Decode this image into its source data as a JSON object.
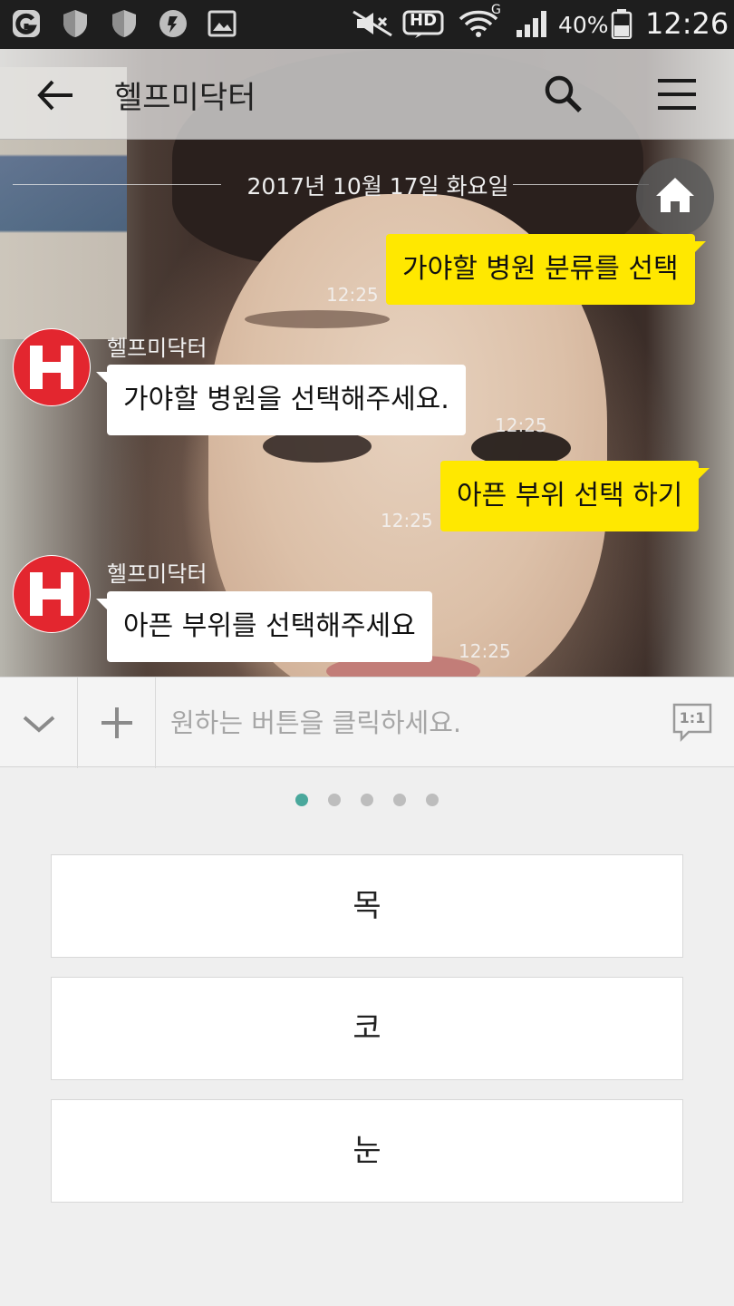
{
  "status_bar": {
    "battery_percent": "40%",
    "time": "12:26",
    "network_label": "HD",
    "wifi_badge": "G",
    "icons": [
      "app-g-icon",
      "shield-icon",
      "shield-icon",
      "location-badge-icon",
      "gallery-icon",
      "mute-icon",
      "hd-icon",
      "wifi-icon",
      "signal-icon",
      "battery-icon"
    ]
  },
  "header": {
    "title": "헬프미닥터",
    "back_icon": "arrow-left-icon",
    "search_icon": "search-icon",
    "menu_icon": "hamburger-menu-icon"
  },
  "chat": {
    "date_divider": "2017년 10월 17일 화요일",
    "home_icon": "home-icon",
    "messages": [
      {
        "from": "me",
        "text": "가야할 병원 분류를 선택",
        "time": "12:25"
      },
      {
        "from": "bot",
        "sender": "헬프미닥터",
        "text": "가야할 병원을 선택해주세요.",
        "time": "12:25"
      },
      {
        "from": "me",
        "text": "아픈 부위 선택 하기",
        "time": "12:25"
      },
      {
        "from": "bot",
        "sender": "헬프미닥터",
        "text": "아픈 부위를 선택해주세요",
        "time": "12:25"
      }
    ],
    "avatar_letter": "H",
    "avatar_color": "#e3262f"
  },
  "input_bar": {
    "placeholder": "원하는 버튼을 클릭하세요.",
    "one_to_one_label": "1:1",
    "collapse_icon": "chevron-down-icon",
    "plus_icon": "plus-icon"
  },
  "quick_replies": {
    "page_count": 5,
    "active_page": 1,
    "buttons": [
      "목",
      "코",
      "눈"
    ]
  },
  "colors": {
    "my_bubble": "#ffe800",
    "bot_bubble": "#ffffff",
    "active_dot": "#4aa89c"
  }
}
